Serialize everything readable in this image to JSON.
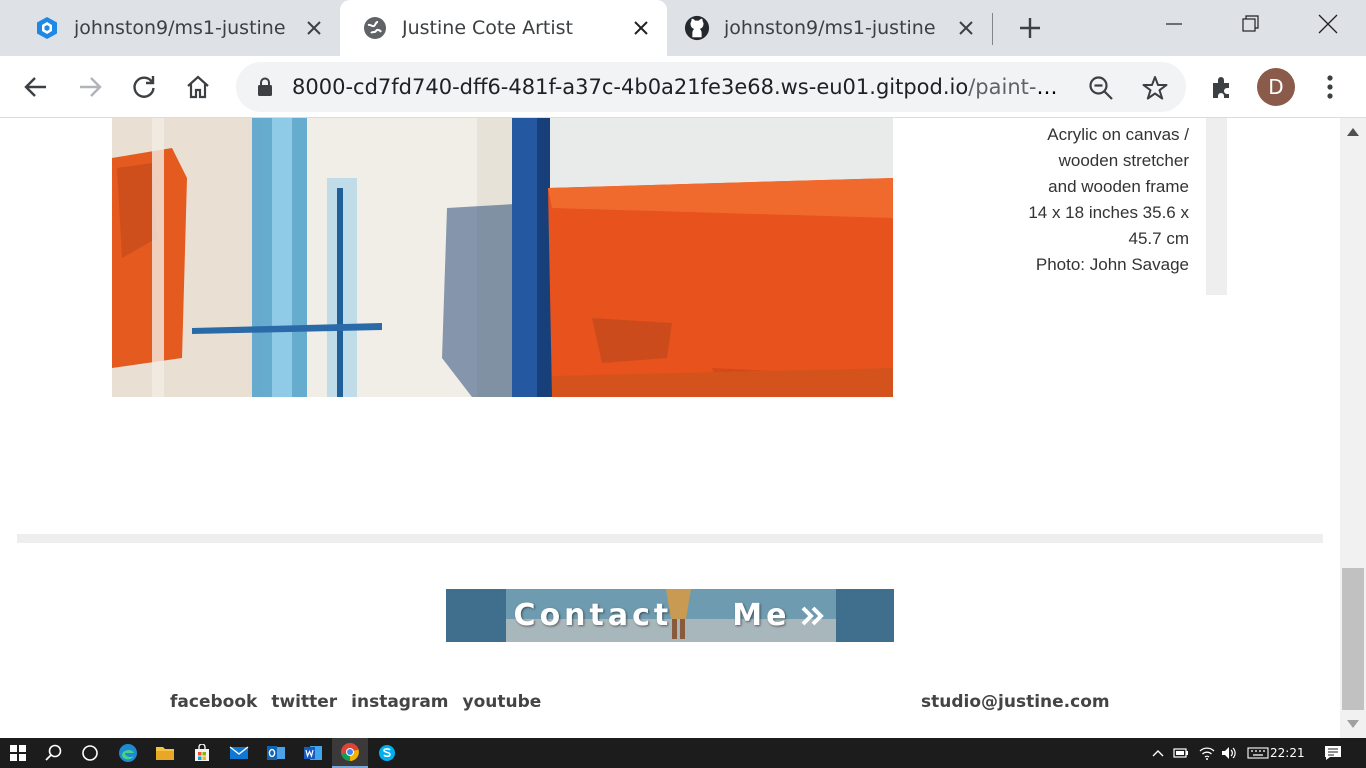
{
  "browser": {
    "tabs": [
      {
        "title": "johnston9/ms1-justine -",
        "icon": "gitpod-icon",
        "active": false
      },
      {
        "title": "Justine Cote Artist",
        "icon": "globe-icon",
        "active": true
      },
      {
        "title": "johnston9/ms1-justine",
        "icon": "github-icon",
        "active": false
      }
    ],
    "url_host": "8000-cd7fd740-dff6-481f-a37c-4b0a21fe3e68.ws-eu01.gitpod.io",
    "url_path": "/paint-p...",
    "profile_initial": "D"
  },
  "page": {
    "artwork_caption": [
      "Acrylic on canvas /",
      "wooden stretcher",
      "and wooden frame",
      "14 x 18 inches 35.6 x",
      "45.7 cm",
      "Photo: John Savage"
    ],
    "contact_word1": "Contact",
    "contact_word2": "Me",
    "contact_icon": "double-chevron-right-icon",
    "social": [
      "facebook",
      "twitter",
      "instagram",
      "youtube"
    ],
    "email": "studio@justine.com"
  },
  "taskbar": {
    "apps": [
      "start-icon",
      "search-icon",
      "task-view-icon",
      "edge-icon",
      "file-explorer-icon",
      "store-icon",
      "mail-icon",
      "outlook-icon",
      "word-icon",
      "chrome-icon",
      "skype-icon"
    ],
    "clock": "22:21"
  },
  "colors": {
    "tab_strip": "#dee1e6",
    "painting_orange": "#e8521c",
    "painting_blue": "#1a4f8a",
    "taskbar": "#1c1c1c"
  }
}
